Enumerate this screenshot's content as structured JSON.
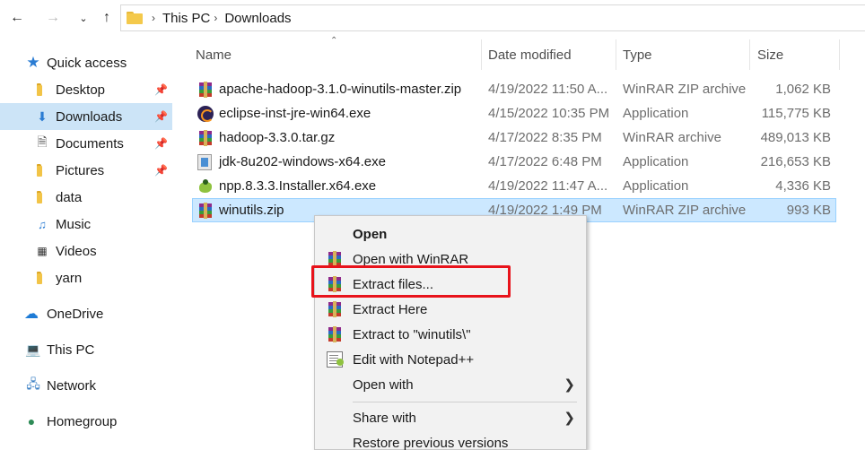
{
  "address": {
    "crumbs": [
      "This PC",
      "Downloads"
    ]
  },
  "sidebar": {
    "items": [
      {
        "label": "Quick access",
        "icon": "star-icon"
      },
      {
        "label": "Desktop",
        "icon": "desktop-folder-icon",
        "pinned": true
      },
      {
        "label": "Downloads",
        "icon": "downloads-folder-icon",
        "pinned": true,
        "active": true
      },
      {
        "label": "Documents",
        "icon": "documents-folder-icon",
        "pinned": true
      },
      {
        "label": "Pictures",
        "icon": "pictures-folder-icon",
        "pinned": true
      },
      {
        "label": "data",
        "icon": "folder-icon"
      },
      {
        "label": "Music",
        "icon": "music-folder-icon"
      },
      {
        "label": "Videos",
        "icon": "videos-folder-icon"
      },
      {
        "label": "yarn",
        "icon": "folder-icon"
      },
      {
        "label": "OneDrive",
        "icon": "cloud-icon"
      },
      {
        "label": "This PC",
        "icon": "computer-icon"
      },
      {
        "label": "Network",
        "icon": "network-icon"
      },
      {
        "label": "Homegroup",
        "icon": "homegroup-icon"
      }
    ]
  },
  "columns": {
    "name": "Name",
    "date": "Date modified",
    "type": "Type",
    "size": "Size"
  },
  "files": [
    {
      "name": "apache-hadoop-3.1.0-winutils-master.zip",
      "date": "4/19/2022 11:50 A...",
      "type": "WinRAR ZIP archive",
      "size": "1,062 KB",
      "icon": "winrar-icon"
    },
    {
      "name": "eclipse-inst-jre-win64.exe",
      "date": "4/15/2022 10:35 PM",
      "type": "Application",
      "size": "115,775 KB",
      "icon": "eclipse-icon"
    },
    {
      "name": "hadoop-3.3.0.tar.gz",
      "date": "4/17/2022 8:35 PM",
      "type": "WinRAR archive",
      "size": "489,013 KB",
      "icon": "winrar-icon"
    },
    {
      "name": "jdk-8u202-windows-x64.exe",
      "date": "4/17/2022 6:48 PM",
      "type": "Application",
      "size": "216,653 KB",
      "icon": "installer-icon"
    },
    {
      "name": "npp.8.3.3.Installer.x64.exe",
      "date": "4/19/2022 11:47 A...",
      "type": "Application",
      "size": "4,336 KB",
      "icon": "notepadpp-icon"
    },
    {
      "name": "winutils.zip",
      "date": "4/19/2022 1:49 PM",
      "type": "WinRAR ZIP archive",
      "size": "993 KB",
      "icon": "winrar-icon",
      "selected": true
    }
  ],
  "context_menu": {
    "items": [
      {
        "label": "Open",
        "bold": true
      },
      {
        "label": "Open with WinRAR",
        "icon": "winrar-icon"
      },
      {
        "label": "Extract files...",
        "icon": "winrar-icon",
        "highlighted": true
      },
      {
        "label": "Extract Here",
        "icon": "winrar-icon"
      },
      {
        "label": "Extract to \"winutils\\\"",
        "icon": "winrar-icon"
      },
      {
        "label": "Edit with Notepad++",
        "icon": "notepadpp-icon"
      },
      {
        "label": "Open with",
        "submenu": true
      },
      {
        "label": "Share with",
        "submenu": true
      },
      {
        "label": "Restore previous versions"
      }
    ]
  },
  "colors": {
    "selection": "#cce8ff",
    "sidebar_active": "#cce4f7",
    "highlight_box": "#e8131b"
  }
}
